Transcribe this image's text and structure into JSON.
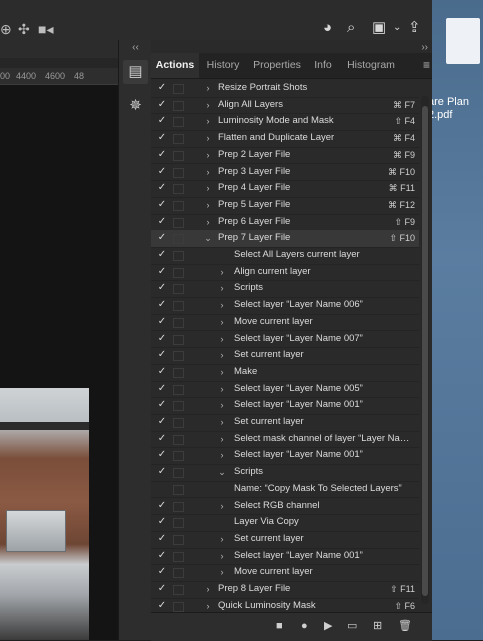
{
  "appbar": {
    "left_icons": [
      "crosshair-icon",
      "move-icon",
      "video-icon"
    ],
    "right_icons": [
      "account-icon",
      "search-icon",
      "workspace-icon",
      "chevron-down-icon",
      "share-icon"
    ]
  },
  "desktop": {
    "filename_line1": "are Plan",
    "filename_line2": "2.pdf"
  },
  "ruler": {
    "ticks": [
      "00",
      "4400",
      "4600",
      "48"
    ]
  },
  "panel": {
    "tabs": [
      "Actions",
      "History",
      "Properties",
      "Info",
      "Histogram"
    ],
    "active_tab": "Actions",
    "rows": [
      {
        "label": "Resize Portrait Shots",
        "key": "",
        "level": 0,
        "expand": "right",
        "check": "✓"
      },
      {
        "label": "Align All Layers",
        "key": "⌘ F7",
        "level": 0,
        "expand": "right",
        "check": "✓"
      },
      {
        "label": "Luminosity Mode and Mask",
        "key": "⇧ F4",
        "level": 0,
        "expand": "right",
        "check": "✓"
      },
      {
        "label": "Flatten and Duplicate Layer",
        "key": "⌘ F4",
        "level": 0,
        "expand": "right",
        "check": "✓"
      },
      {
        "label": "Prep 2 Layer File",
        "key": "⌘ F9",
        "level": 0,
        "expand": "right",
        "check": "✓"
      },
      {
        "label": "Prep 3 Layer File",
        "key": "⌘ F10",
        "level": 0,
        "expand": "right",
        "check": "✓"
      },
      {
        "label": "Prep 4 Layer File",
        "key": "⌘ F11",
        "level": 0,
        "expand": "right",
        "check": "✓"
      },
      {
        "label": "Prep 5 Layer File",
        "key": "⌘ F12",
        "level": 0,
        "expand": "right",
        "check": "✓"
      },
      {
        "label": "Prep 6 Layer File",
        "key": "⇧ F9",
        "level": 0,
        "expand": "right",
        "check": "✓"
      },
      {
        "label": "Prep 7 Layer File",
        "key": "⇧ F10",
        "level": 0,
        "expand": "down",
        "check": "✓",
        "selected": true
      },
      {
        "label": "Select All Layers current layer",
        "key": "",
        "level": 1,
        "expand": "",
        "check": "✓"
      },
      {
        "label": "Align current layer",
        "key": "",
        "level": 1,
        "expand": "right",
        "check": "✓"
      },
      {
        "label": "Scripts",
        "key": "",
        "level": 1,
        "expand": "right",
        "check": "✓"
      },
      {
        "label": "Select layer “Layer Name 006”",
        "key": "",
        "level": 1,
        "expand": "right",
        "check": "✓"
      },
      {
        "label": "Move current layer",
        "key": "",
        "level": 1,
        "expand": "right",
        "check": "✓"
      },
      {
        "label": "Select layer “Layer Name 007”",
        "key": "",
        "level": 1,
        "expand": "right",
        "check": "✓"
      },
      {
        "label": "Set current layer",
        "key": "",
        "level": 1,
        "expand": "right",
        "check": "✓"
      },
      {
        "label": "Make",
        "key": "",
        "level": 1,
        "expand": "right",
        "check": "✓"
      },
      {
        "label": "Select layer “Layer Name 005”",
        "key": "",
        "level": 1,
        "expand": "right",
        "check": "✓"
      },
      {
        "label": "Select layer “Layer Name 001”",
        "key": "",
        "level": 1,
        "expand": "right",
        "check": "✓"
      },
      {
        "label": "Set current layer",
        "key": "",
        "level": 1,
        "expand": "right",
        "check": "✓"
      },
      {
        "label": "Select mask channel of layer “Layer Name ...",
        "key": "",
        "level": 1,
        "expand": "right",
        "check": "✓"
      },
      {
        "label": "Select layer “Layer Name 001”",
        "key": "",
        "level": 1,
        "expand": "right",
        "check": "✓"
      },
      {
        "label": "Scripts",
        "key": "",
        "level": 1,
        "expand": "down",
        "check": "✓"
      },
      {
        "label": "Name:  “Copy Mask To Selected Layers”",
        "key": "",
        "level": 2,
        "expand": "",
        "check": ""
      },
      {
        "label": "Select RGB channel",
        "key": "",
        "level": 1,
        "expand": "right",
        "check": "✓"
      },
      {
        "label": "Layer Via Copy",
        "key": "",
        "level": 1,
        "expand": "",
        "check": "✓"
      },
      {
        "label": "Set current layer",
        "key": "",
        "level": 1,
        "expand": "right",
        "check": "✓"
      },
      {
        "label": "Select layer “Layer Name 001”",
        "key": "",
        "level": 1,
        "expand": "right",
        "check": "✓"
      },
      {
        "label": "Move current layer",
        "key": "",
        "level": 1,
        "expand": "right",
        "check": "✓"
      },
      {
        "label": "Prep 8 Layer File",
        "key": "⇧ F11",
        "level": 0,
        "expand": "right",
        "check": "✓"
      },
      {
        "label": "Quick Luminosity Mask",
        "key": "⇧ F6",
        "level": 0,
        "expand": "right",
        "check": "✓"
      }
    ],
    "footer_buttons": [
      {
        "name": "stop-icon",
        "glyph": "■"
      },
      {
        "name": "record-icon",
        "glyph": "●"
      },
      {
        "name": "play-icon",
        "glyph": "▶"
      },
      {
        "name": "folder-icon",
        "glyph": "▭"
      },
      {
        "name": "new-action-icon",
        "glyph": "⊞"
      },
      {
        "name": "trash-icon",
        "glyph": "🗑"
      }
    ]
  }
}
